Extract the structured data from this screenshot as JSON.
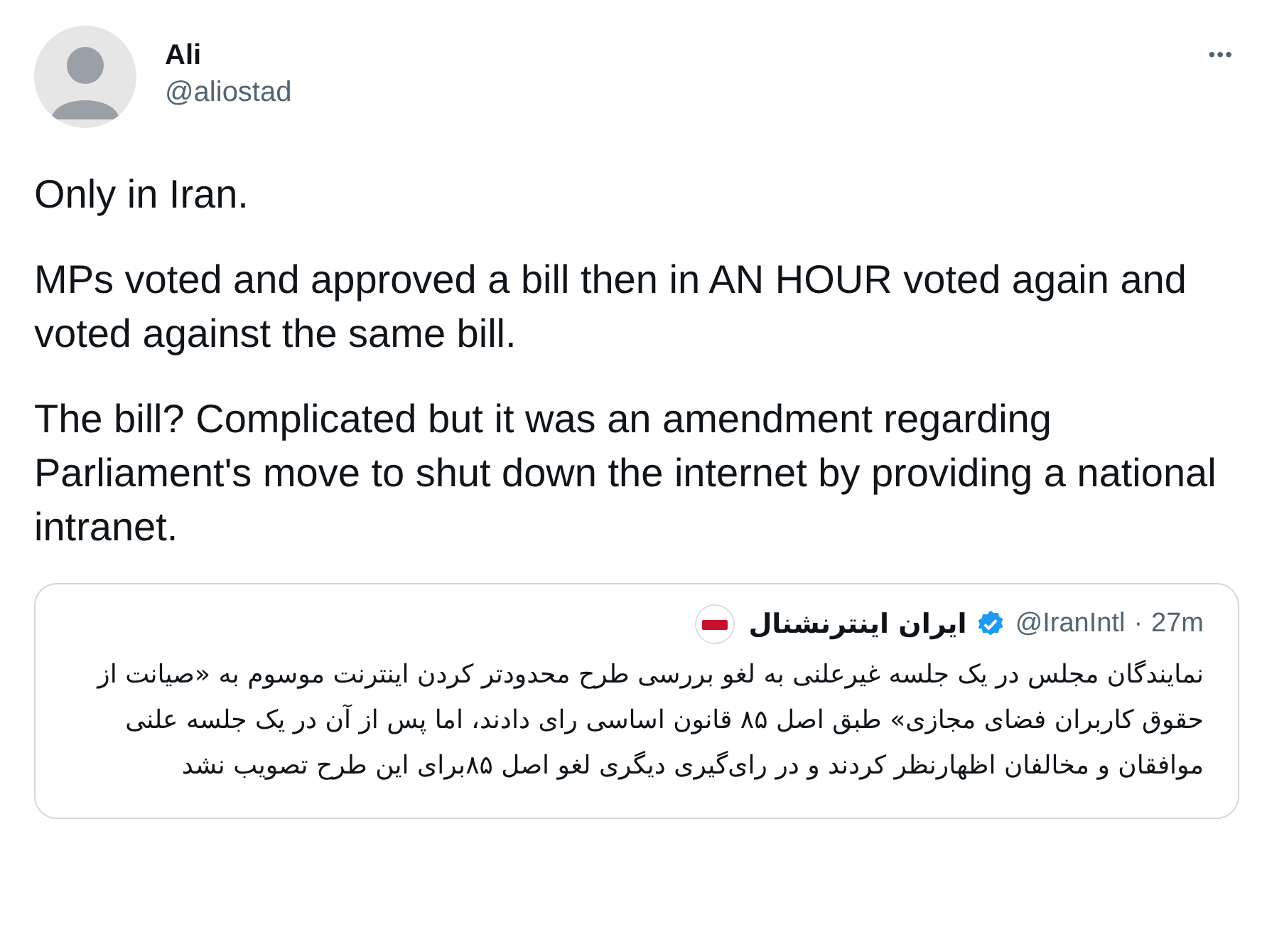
{
  "author": {
    "name": "Ali",
    "handle": "@aliostad"
  },
  "more_icon": "•••",
  "paragraphs": [
    "Only in Iran.",
    "MPs voted and approved a bill then in AN HOUR voted again and voted against the same bill.",
    "The bill? Complicated but it was an amendment regarding Parliament's move to shut down the internet by providing a national intranet."
  ],
  "quoted": {
    "name": "ایران اینترنشنال",
    "verified": true,
    "handle": "@IranIntl",
    "separator": "·",
    "time": "27m",
    "text": "نمایندگان مجلس در یک جلسه غیرعلنی به لغو بررسی طرح محدودتر کردن اینترنت موسوم به «صیانت از حقوق کاربران فضای مجازی» طبق اصل ۸۵ قانون اساسی رای دادند، اما پس از آن در یک جلسه علنی موافقان و مخالفان اظهارنظر کردند و در رای‌گیری دیگری لغو اصل ۸۵برای این طرح تصویب نشد"
  }
}
